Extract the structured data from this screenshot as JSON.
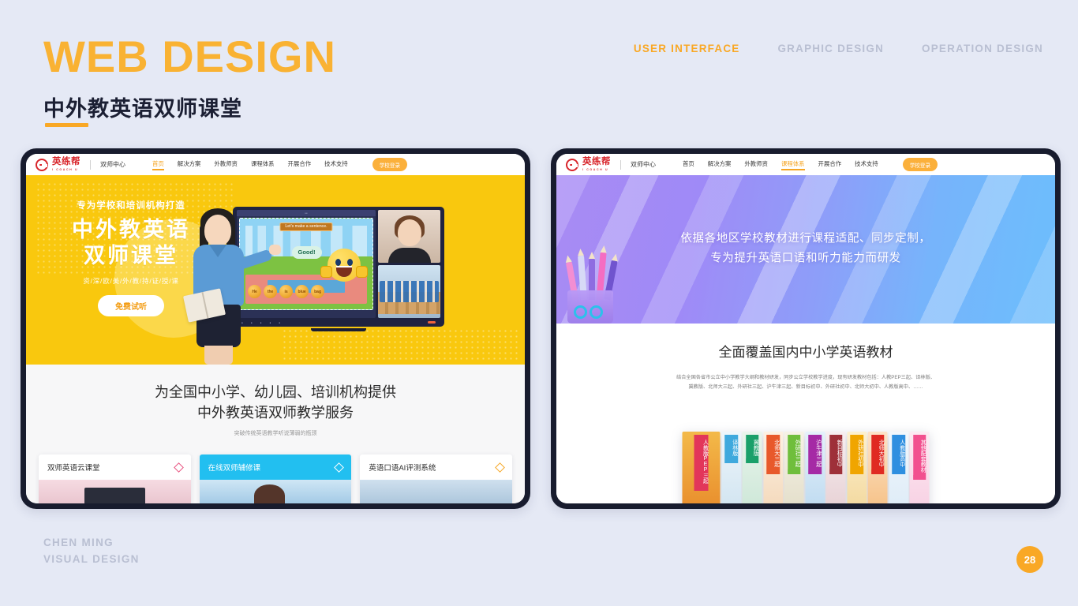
{
  "header": {
    "title": "WEB DESIGN",
    "subtitle": "中外教英语双师课堂",
    "nav": [
      {
        "label": "USER INTERFACE",
        "active": true
      },
      {
        "label": "GRAPHIC DESIGN",
        "active": false
      },
      {
        "label": "OPERATION DESIGN",
        "active": false
      }
    ]
  },
  "site": {
    "logo_cn": "英练帮",
    "logo_en": "I COACH U",
    "logo_sub": "双师中心",
    "nav_items": [
      "首页",
      "解决方案",
      "外教师资",
      "课程体系",
      "开展合作",
      "技术支持"
    ],
    "login_label": "学校登录"
  },
  "left_screen": {
    "active_nav": "首页",
    "hero": {
      "kicker": "专为学校和培训机构打造",
      "line1": "中外教英语",
      "line2": "双师课堂",
      "tagline": "资/深/欧/美/外/教/持/证/授/课",
      "button": "免费试听",
      "board_banner": "Let's make a sentence.",
      "board_bubble": "Good!",
      "ball_words": [
        "He",
        "the",
        "is",
        "blue",
        "bag"
      ]
    },
    "section": {
      "heading_line1": "为全国中小学、幼儿园、培训机构提供",
      "heading_line2": "中外教英语双师教学服务",
      "subtext": "突破传统英语教学听说薄弱的瓶颈"
    },
    "cards": [
      {
        "title": "双师英语云课堂",
        "accent": "#e8527f",
        "active": false
      },
      {
        "title": "在线双师辅修课",
        "accent": "#ffffff",
        "active": true
      },
      {
        "title": "英语口语AI评测系统",
        "accent": "#f6a623",
        "active": false
      }
    ]
  },
  "right_screen": {
    "active_nav": "课程体系",
    "hero": {
      "line1": "依据各地区学校教材进行课程适配、同步定制，",
      "line2": "专为提升英语口语和听力能力而研发"
    },
    "section": {
      "heading": "全面覆盖国内中小学英语教材",
      "paragraph_line1": "结合全国各省市公立中小学教学大纲和教材研发，同步公立学校教学进度，现有研发教材包括：人教PEP三起、译林版、",
      "paragraph_line2": "冀教版、北师大三起、外研社三起、沪牛津三起、新目标初中、外研社初中、北师大初中、人教版高中、……"
    },
    "books": [
      {
        "label": "人教版PEP三起",
        "color": "#e2365a",
        "cover": "linear-gradient(#f3b949,#e88a2a)"
      },
      {
        "label": "译林版",
        "color": "#3fa9dd",
        "cover": "linear-gradient(#eef6fb,#cfe3f0)"
      },
      {
        "label": "冀教版",
        "color": "#1aa06a",
        "cover": "linear-gradient(#e9f5ec,#cbe6d6)"
      },
      {
        "label": "北师大三起",
        "color": "#e8592b",
        "cover": "linear-gradient(#fdf1e3,#f3d7b8)"
      },
      {
        "label": "外研社三起",
        "color": "#6fbe3c",
        "cover": "linear-gradient(#f6f2e6,#e2ddc8)"
      },
      {
        "label": "沪牛津三起",
        "color": "#a52aa5",
        "cover": "linear-gradient(#e4f1fb,#bcd9ef)"
      },
      {
        "label": "新目标初中",
        "color": "#9e3039",
        "cover": "linear-gradient(#f7eef0,#e6cfd3)"
      },
      {
        "label": "外研社初中",
        "color": "#f0a500",
        "cover": "linear-gradient(#fdf0cf,#f2d79b)"
      },
      {
        "label": "北师大初中",
        "color": "#e02a22",
        "cover": "linear-gradient(#fde3c8,#f5bf82)"
      },
      {
        "label": "人教版高中",
        "color": "#2f8fe0",
        "cover": "linear-gradient(#f2f7fc,#dcebf7)"
      },
      {
        "label": "其他配套教材",
        "color": "#f2508f",
        "cover": "linear-gradient(#fdeaf3,#f7cfe2)"
      }
    ]
  },
  "footer": {
    "line1": "CHEN MING",
    "line2": "VISUAL DESIGN",
    "page_number": "28"
  }
}
